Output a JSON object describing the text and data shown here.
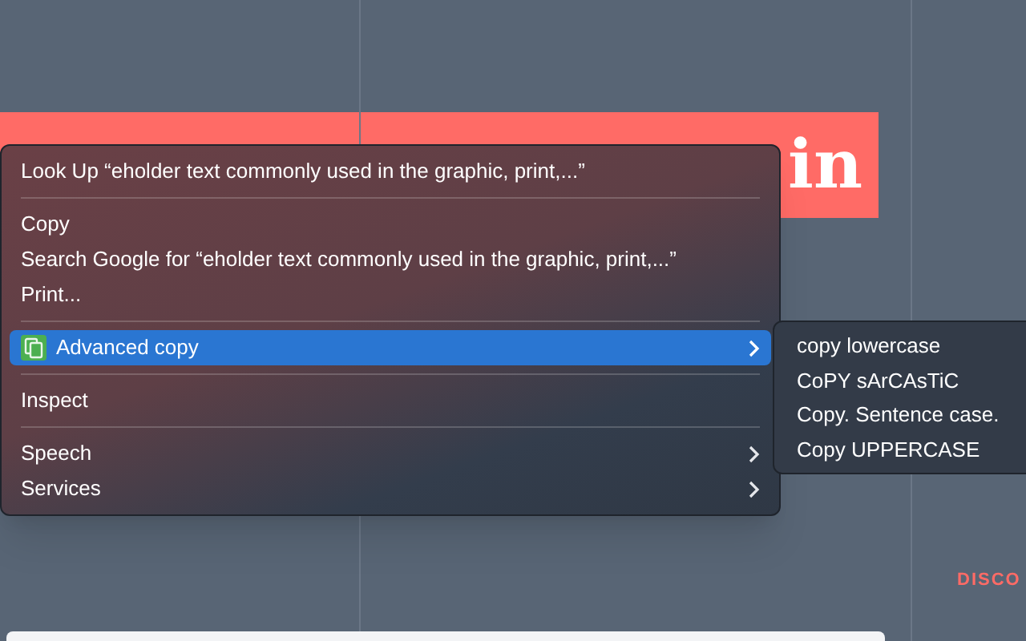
{
  "page": {
    "headline_fragment": "in",
    "section_label": "DISCO"
  },
  "context_menu": {
    "items": [
      {
        "kind": "item",
        "label": "Look Up “eholder text commonly used in the graphic, print,...”",
        "selected": false,
        "submenu": false
      },
      {
        "kind": "separator"
      },
      {
        "kind": "item",
        "label": "Copy",
        "selected": false,
        "submenu": false
      },
      {
        "kind": "item",
        "label": "Search Google for “eholder text commonly used in the graphic, print,...”",
        "selected": false,
        "submenu": false
      },
      {
        "kind": "item",
        "label": "Print...",
        "selected": false,
        "submenu": false
      },
      {
        "kind": "separator"
      },
      {
        "kind": "item",
        "label": "Advanced copy",
        "selected": true,
        "submenu": true,
        "icon": true
      },
      {
        "kind": "separator"
      },
      {
        "kind": "item",
        "label": "Inspect",
        "selected": false,
        "submenu": false
      },
      {
        "kind": "separator"
      },
      {
        "kind": "item",
        "label": "Speech",
        "selected": false,
        "submenu": true
      },
      {
        "kind": "item",
        "label": "Services",
        "selected": false,
        "submenu": true
      }
    ]
  },
  "submenu": {
    "items": [
      {
        "label": "copy lowercase"
      },
      {
        "label": "CoPY sArCAsTiC"
      },
      {
        "label": "Copy. Sentence case."
      },
      {
        "label": "Copy UPPERCASE"
      }
    ]
  }
}
